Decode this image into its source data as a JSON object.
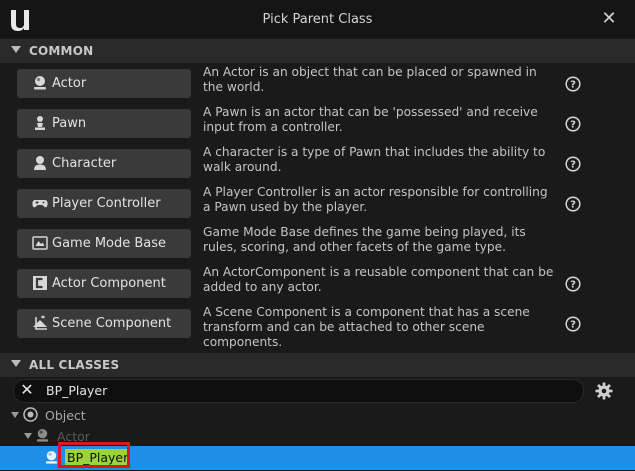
{
  "window": {
    "title": "Pick Parent Class"
  },
  "common": {
    "header": "COMMON",
    "classes": [
      {
        "label": "Actor",
        "icon": "actor-icon",
        "description": "An Actor is an object that can be placed or spawned in the world."
      },
      {
        "label": "Pawn",
        "icon": "pawn-icon",
        "description": "A Pawn is an actor that can be 'possessed' and receive input from a controller."
      },
      {
        "label": "Character",
        "icon": "character-icon",
        "description": "A character is a type of Pawn that includes the ability to walk around."
      },
      {
        "label": "Player Controller",
        "icon": "gamepad-icon",
        "description": "A Player Controller is an actor responsible for controlling a Pawn used by the player."
      },
      {
        "label": "Game Mode Base",
        "icon": "game-mode-icon",
        "description": "Game Mode Base defines the game being played, its rules, scoring, and other facets of the game type."
      },
      {
        "label": "Actor Component",
        "icon": "actor-component-icon",
        "description": "An ActorComponent is a reusable component that can be added to any actor."
      },
      {
        "label": "Scene Component",
        "icon": "scene-component-icon",
        "description": "A Scene Component is a component that has a scene transform and can be attached to other scene components."
      }
    ]
  },
  "all_classes": {
    "header": "ALL CLASSES",
    "search_value": "BP_Player",
    "tree": [
      {
        "label": "Object",
        "icon": "object-icon"
      },
      {
        "label": "Actor",
        "icon": "actor-icon"
      },
      {
        "label": "BP_Player",
        "icon": "blueprint-icon",
        "selected": true
      }
    ]
  },
  "colors": {
    "selection": "#1e8fe6",
    "search_highlight": "#9ad43b",
    "annotation": "#e0141e"
  }
}
